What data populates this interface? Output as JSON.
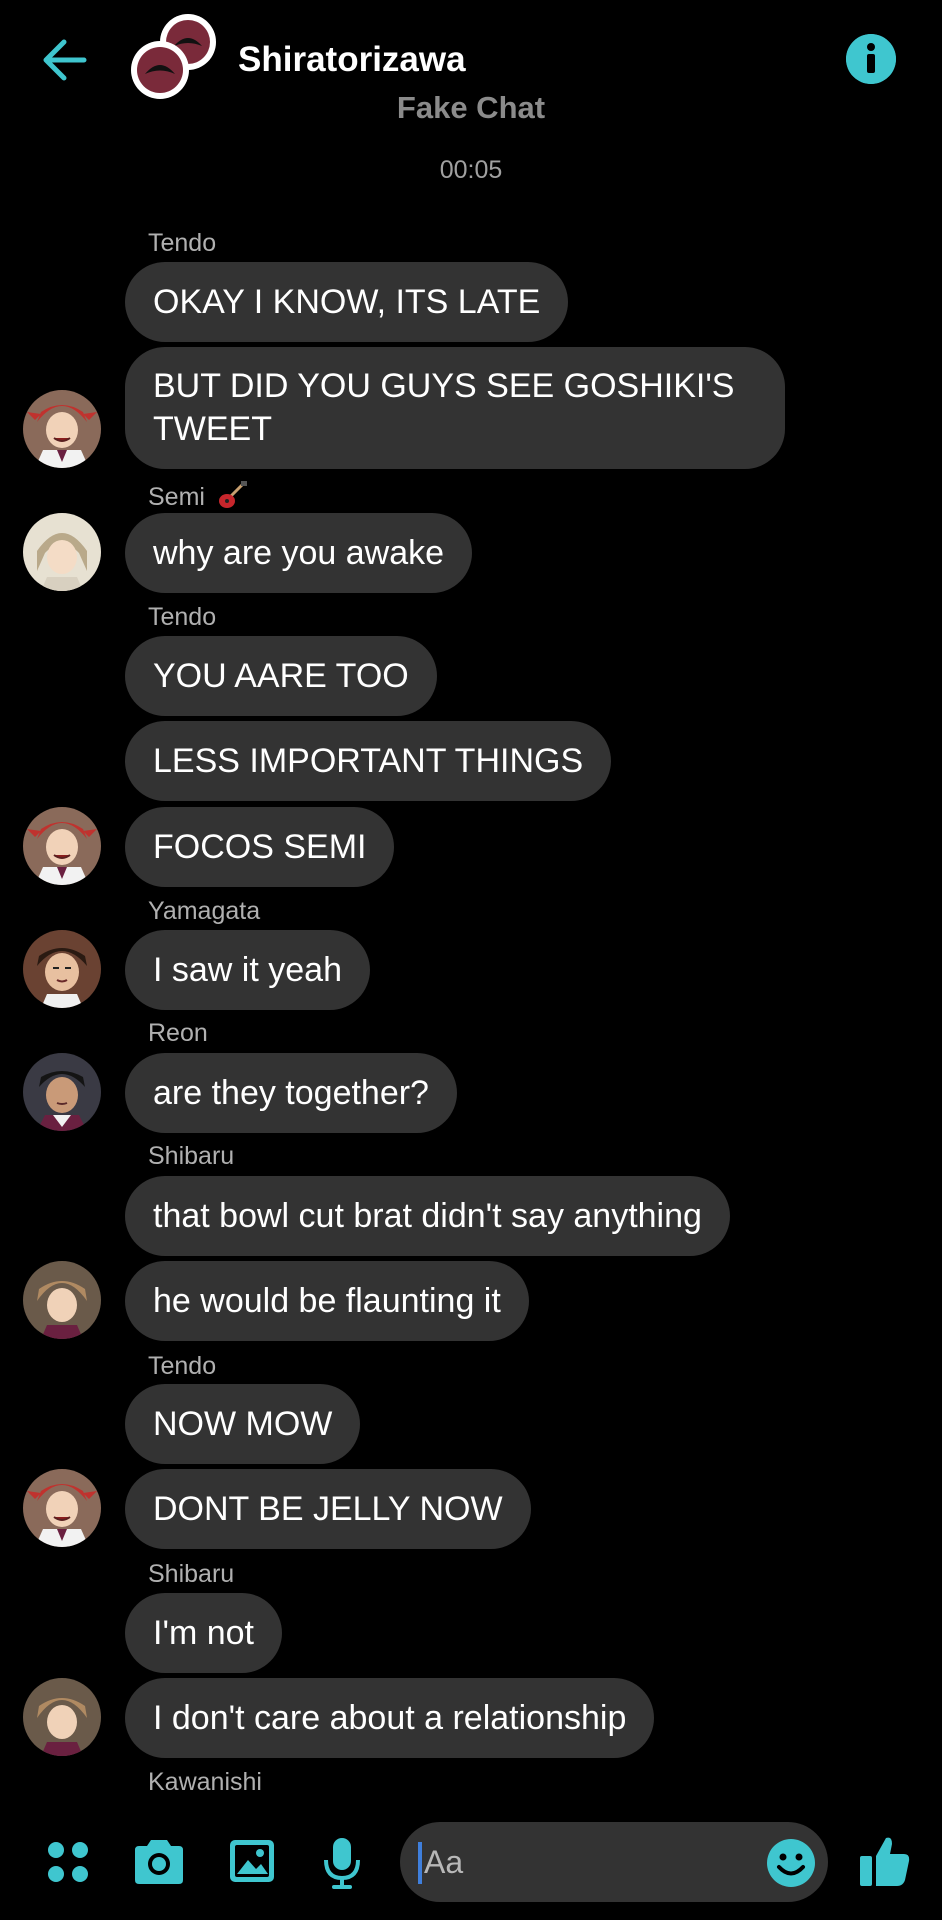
{
  "header": {
    "title": "Shiratorizawa",
    "subtitle": "Fake Chat",
    "accent": "#3fc6cf"
  },
  "timestamp": "00:05",
  "senders": {
    "s1": "Tendo",
    "s2": "Semi",
    "s3": "Tendo",
    "s4": "Yamagata",
    "s5": "Reon",
    "s6": "Shibaru",
    "s7": "Tendo",
    "s8": "Shibaru",
    "s9": "Kawanishi"
  },
  "messages": {
    "m1": "OKAY I KNOW, ITS LATE",
    "m2a": "BUT DID YOU GUYS SEE GOSHIKI'S",
    "m2b": "TWEET",
    "m3": "why are you awake",
    "m4": "YOU AARE TOO",
    "m5": "LESS IMPORTANT THINGS",
    "m6": "FOCOS SEMI",
    "m7": "I saw it yeah",
    "m8": "are they together?",
    "m9": "that bowl cut brat didn't say anything",
    "m10": "he would be flaunting it",
    "m11": "NOW MOW",
    "m12": "DONT BE JELLY NOW",
    "m13": "I'm not",
    "m14": "I don't care about a relationship"
  },
  "composer": {
    "placeholder": "Aa",
    "icons": [
      "apps-icon",
      "camera-icon",
      "image-icon",
      "microphone-icon",
      "emoji-icon",
      "thumbs-up-icon"
    ]
  }
}
